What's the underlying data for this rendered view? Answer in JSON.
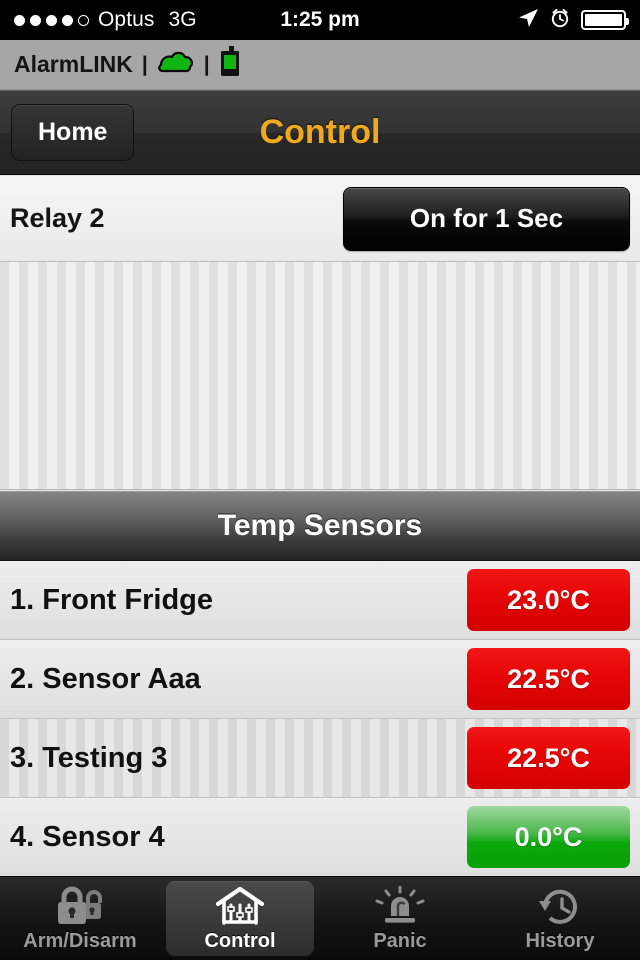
{
  "statusbar": {
    "signal_dots_total": 5,
    "signal_dots_filled": 4,
    "carrier": "Optus",
    "network": "3G",
    "time": "1:25 pm",
    "location_icon": "location-arrow-icon",
    "alarm_icon": "alarm-clock-icon",
    "battery_icon": "battery-full-icon",
    "battery_level": 100
  },
  "brandbar": {
    "title": "AlarmLINK",
    "separator": "|",
    "cloud_icon": "cloud-icon",
    "device_icon": "radio-device-icon",
    "cloud_color": "#11b511",
    "device_color": "#11b511",
    "background": "#a6a6a6"
  },
  "navbar": {
    "back_label": "Home",
    "title": "Control",
    "title_color": "#f0a81e"
  },
  "relay": {
    "label": "Relay 2",
    "button_label": "On for 1 Sec"
  },
  "temp_section": {
    "header": "Temp Sensors",
    "sensors": [
      {
        "name": "1. Front Fridge",
        "value": "23.0°C",
        "state": "red"
      },
      {
        "name": "2. Sensor Aaa",
        "value": "22.5°C",
        "state": "red"
      },
      {
        "name": "3. Testing 3",
        "value": "22.5°C",
        "state": "red"
      },
      {
        "name": "4. Sensor 4",
        "value": "0.0°C",
        "state": "green"
      }
    ],
    "red_color": "#e80707",
    "green_color": "#0aa80a"
  },
  "tabbar": {
    "active_index": 1,
    "tabs": [
      {
        "label": "Arm/Disarm",
        "icon": "padlock-pair-icon"
      },
      {
        "label": "Control",
        "icon": "house-sliders-icon"
      },
      {
        "label": "Panic",
        "icon": "siren-icon"
      },
      {
        "label": "History",
        "icon": "clock-rewind-icon"
      }
    ]
  }
}
